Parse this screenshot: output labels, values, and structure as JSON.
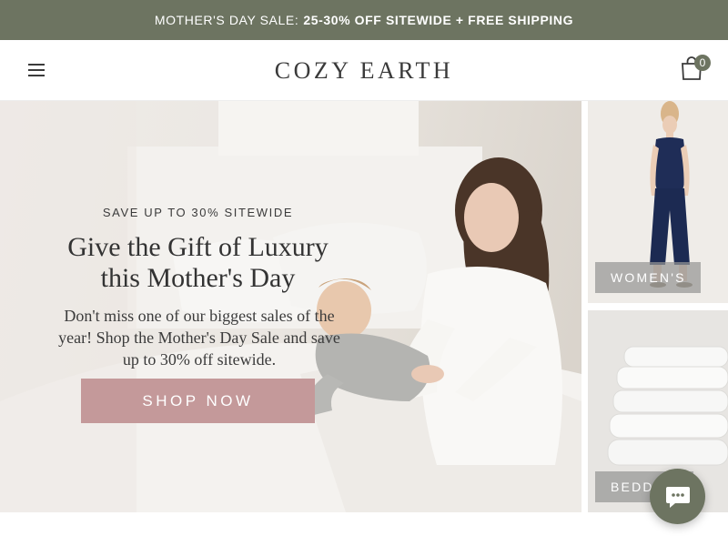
{
  "announcement": {
    "lead": "MOTHER'S DAY SALE:",
    "promo": "25-30% OFF SITEWIDE + FREE SHIPPING"
  },
  "header": {
    "logo": "COZY EARTH",
    "menu_icon": "hamburger-menu-icon",
    "cart_icon": "shopping-bag-icon",
    "cart_count": "0"
  },
  "hero": {
    "eyebrow": "SAVE UP TO 30% SITEWIDE",
    "headline_line1": "Give the Gift of Luxury",
    "headline_line2": "this Mother's Day",
    "subcopy": "Don't miss one of our biggest sales of the year! Shop the Mother's Day Sale and save up to 30% off sitewide.",
    "cta": "SHOP NOW"
  },
  "tiles": [
    {
      "label": "WOMEN'S"
    },
    {
      "label": "BEDDI"
    }
  ],
  "chat": {
    "icon": "chat-bubble-icon"
  },
  "colors": {
    "announcement_bg": "#6d7461",
    "cta_bg": "#c4999a",
    "tile_label_bg": "#969694",
    "text_dark": "#333333"
  }
}
